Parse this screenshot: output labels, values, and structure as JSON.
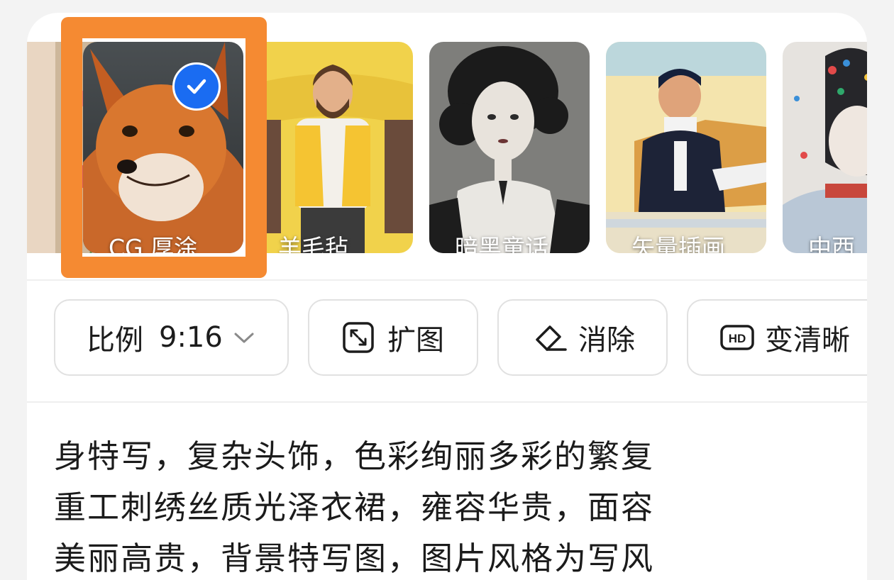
{
  "styles": [
    {
      "label": "",
      "thumb": "flower-painting",
      "selected": false
    },
    {
      "label": "CG 厚涂",
      "thumb": "fox-portrait",
      "selected": true
    },
    {
      "label": "羊毛毡",
      "thumb": "felt-man-yellow-vest",
      "selected": false
    },
    {
      "label": "暗黑童话",
      "thumb": "dark-fairy-tale-woman",
      "selected": false
    },
    {
      "label": "矢量插画",
      "thumb": "vector-man-at-desk",
      "selected": false
    },
    {
      "label": "中西",
      "thumb": "colorful-portrait",
      "selected": false
    }
  ],
  "selection_icon": "check-icon",
  "toolbar": {
    "ratio_label": "比例",
    "ratio_value": "9:16",
    "ratio_icon": "chevron-down-icon",
    "expand_label": "扩图",
    "expand_icon": "expand-icon",
    "erase_label": "消除",
    "erase_icon": "eraser-icon",
    "enhance_label": "变清晰",
    "enhance_icon": "hd-icon"
  },
  "prompt_lines": [
    "身特写，复杂头饰，色彩绚丽多彩的繁复",
    "重工刺绣丝质光泽衣裙，雍容华贵，面容",
    "美丽高贵，背景特写图，图片风格为写风"
  ],
  "colors": {
    "accent": "#1a6cf2",
    "highlight": "#f58a32",
    "card": "#ffffff",
    "page": "#f3f3f3"
  }
}
